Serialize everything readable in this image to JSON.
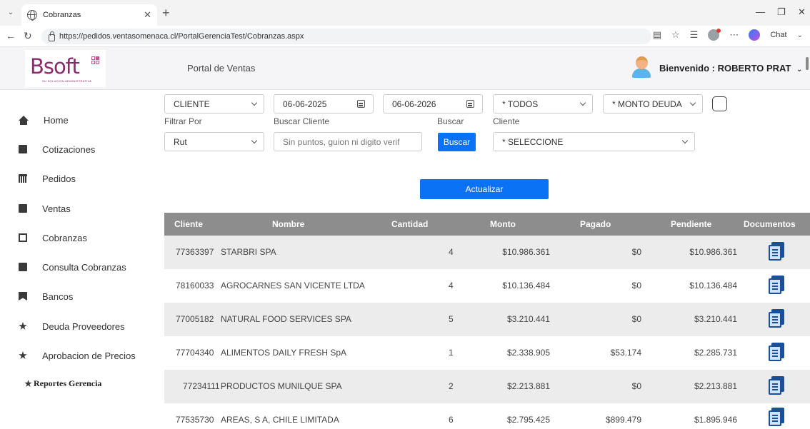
{
  "browser": {
    "tab_title": "Cobranzas",
    "url": "https://pedidos.ventasomenaca.cl/PortalGerenciaTest/Cobranzas.aspx",
    "chat_label": "Chat"
  },
  "header": {
    "logo_text": "Bsoft",
    "logo_tagline": "SU SOLUCIÓN ADMINISTRATIVA",
    "portal_title": "Portal de Ventas",
    "welcome": "Bienvenido : ROBERTO PRAT"
  },
  "sidebar": {
    "items": [
      {
        "label": "Home",
        "icon": "home-icon"
      },
      {
        "label": "Cotizaciones",
        "icon": "file-icon"
      },
      {
        "label": "Pedidos",
        "icon": "calendar-icon"
      },
      {
        "label": "Ventas",
        "icon": "file-icon"
      },
      {
        "label": "Cobranzas",
        "icon": "edit-icon"
      },
      {
        "label": "Consulta Cobranzas",
        "icon": "book-icon"
      },
      {
        "label": "Bancos",
        "icon": "bookmark-icon"
      },
      {
        "label": "Deuda Proveedores",
        "icon": "gear-icon"
      },
      {
        "label": "Aprobacion de Precios",
        "icon": "gear-icon"
      }
    ],
    "reportes": "Reportes Gerencia"
  },
  "filters": {
    "type_select": "CLIENTE",
    "date_from": "06-06-2025",
    "date_to": "06-06-2026",
    "todos_select": "* TODOS",
    "monto_select": "* MONTO DEUDA",
    "filtrar_label": "Filtrar Por",
    "buscar_cliente_label": "Buscar Cliente",
    "buscar_label": "Buscar",
    "cliente_label": "Cliente",
    "filtrar_select": "Rut",
    "search_placeholder": "Sin puntos, guion ni digito verif",
    "buscar_button": "Buscar",
    "cliente_select": "* SELECCIONE",
    "actualizar_button": "Actualizar"
  },
  "table": {
    "headers": [
      "Cliente",
      "Nombre",
      "Cantidad",
      "Monto",
      "Pagado",
      "Pendiente",
      "Documentos"
    ],
    "rows": [
      {
        "rut": "77363397",
        "nombre": "STARBRI SPA",
        "cantidad": "4",
        "monto": "$10.986.361",
        "pagado": "$0",
        "pendiente": "$10.986.361"
      },
      {
        "rut": "78160033",
        "nombre": "AGROCARNES SAN VICENTE LTDA",
        "cantidad": "4",
        "monto": "$10.136.484",
        "pagado": "$0",
        "pendiente": "$10.136.484"
      },
      {
        "rut": "77005182",
        "nombre": "NATURAL FOOD SERVICES SPA",
        "cantidad": "5",
        "monto": "$3.210.441",
        "pagado": "$0",
        "pendiente": "$3.210.441"
      },
      {
        "rut": "77704340",
        "nombre": "ALIMENTOS DAILY FRESH SpA",
        "cantidad": "1",
        "monto": "$2.338.905",
        "pagado": "$53.174",
        "pendiente": "$2.285.731"
      },
      {
        "rut": "77234111",
        "nombre": "PRODUCTOS MUNILQUE SPA",
        "cantidad": "2",
        "monto": "$2.213.881",
        "pagado": "$0",
        "pendiente": "$2.213.881"
      },
      {
        "rut": "77535730",
        "nombre": "AREAS, S A, CHILE LIMITADA",
        "cantidad": "6",
        "monto": "$2.795.425",
        "pagado": "$899.479",
        "pendiente": "$1.895.946"
      }
    ]
  }
}
